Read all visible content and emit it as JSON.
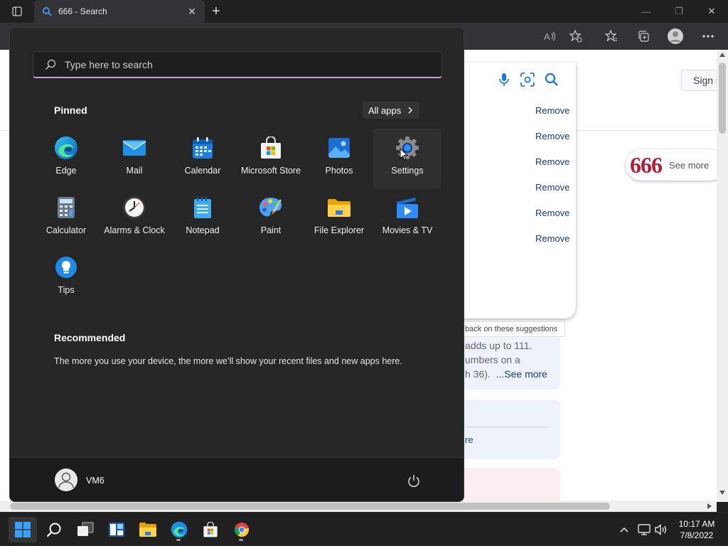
{
  "browser": {
    "tab_title": "666 - Search",
    "tab_close_glyph": "✕",
    "new_tab_glyph": "+",
    "window_controls": [
      "—",
      "❐",
      "✕"
    ]
  },
  "page": {
    "sign_in": "Sign i",
    "suggestions": [
      "Remove",
      "Remove",
      "Remove",
      "Remove",
      "Remove",
      "Remove"
    ],
    "chip_number": "666",
    "chip_label": "See more",
    "feedback": "back on these suggestions",
    "snippet_lines": [
      "adds up to 111.",
      "umbers on a",
      "h 36)."
    ],
    "snippet_more": "...See more",
    "card_link": "re"
  },
  "start_menu": {
    "search_placeholder": "Type here to search",
    "pinned_title": "Pinned",
    "all_apps_label": "All apps",
    "apps": [
      {
        "name": "Edge",
        "icon": "edge-icon"
      },
      {
        "name": "Mail",
        "icon": "mail-icon"
      },
      {
        "name": "Calendar",
        "icon": "calendar-icon"
      },
      {
        "name": "Microsoft Store",
        "icon": "store-icon"
      },
      {
        "name": "Photos",
        "icon": "photos-icon"
      },
      {
        "name": "Settings",
        "icon": "settings-gear-icon"
      },
      {
        "name": "Calculator",
        "icon": "calculator-icon"
      },
      {
        "name": "Alarms & Clock",
        "icon": "clock-icon"
      },
      {
        "name": "Notepad",
        "icon": "notepad-icon"
      },
      {
        "name": "Paint",
        "icon": "paint-palette-icon"
      },
      {
        "name": "File Explorer",
        "icon": "folder-icon"
      },
      {
        "name": "Movies & TV",
        "icon": "movies-play-icon"
      },
      {
        "name": "Tips",
        "icon": "lightbulb-icon"
      }
    ],
    "recommended_title": "Recommended",
    "recommended_text": "The more you use your device, the more we’ll show your recent files and new apps here.",
    "user_name": "VM6"
  },
  "taskbar": {
    "items": [
      "start-icon",
      "search-icon",
      "task-view-icon",
      "widgets-icon",
      "file-explorer-icon",
      "edge-icon",
      "store-icon",
      "chrome-icon"
    ],
    "time": "10:17 AM",
    "date": "7/8/2022"
  },
  "colors": {
    "accent": "#0078d4",
    "search_underline": "#c6a0d4",
    "link": "#1a3a8a"
  }
}
